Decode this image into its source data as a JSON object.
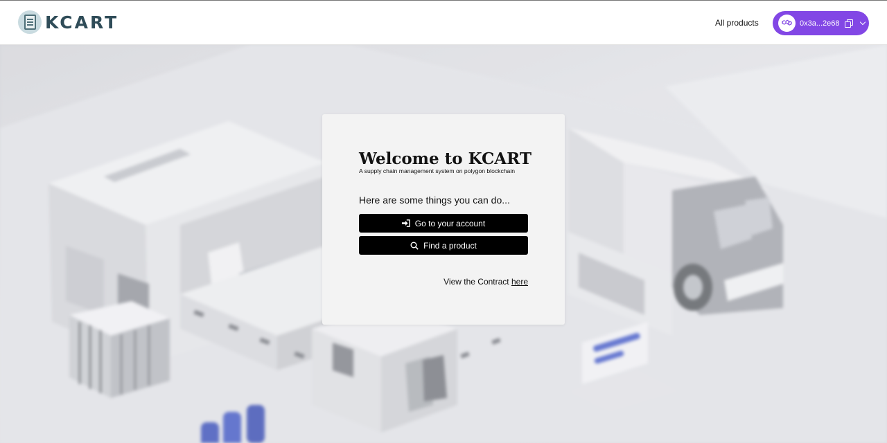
{
  "header": {
    "logo_text": "KCART",
    "nav_all_products": "All products",
    "wallet": {
      "address": "0x3a...2e68",
      "accent_color": "#8247e5",
      "icons": [
        "polygon-icon",
        "copy-icon",
        "chevron-down-icon"
      ]
    }
  },
  "card": {
    "title": "Welcome to KCART",
    "subtitle": "A supply chain management system on polygon blockchain",
    "lead": "Here are some things you can do...",
    "buttons": [
      {
        "label": "Go to your account",
        "icon": "sign-in-icon"
      },
      {
        "label": "Find a product",
        "icon": "search-icon"
      }
    ],
    "contract_prefix": "View the Contract ",
    "contract_link": "here"
  }
}
